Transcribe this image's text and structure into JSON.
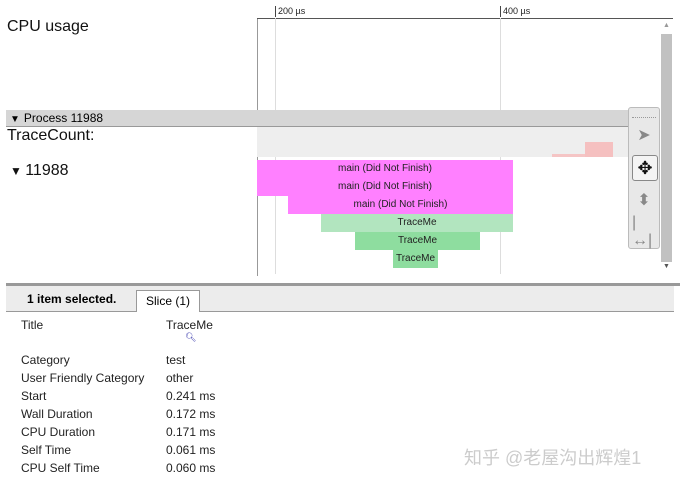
{
  "tracks": {
    "cpu_usage": "CPU usage",
    "process_label": "Process 11988",
    "trace_count": "TraceCount:",
    "thread": "11988"
  },
  "ruler": {
    "ticks": [
      "200 µs",
      "400 µs"
    ]
  },
  "slices": [
    {
      "label": "main (Did Not Finish)",
      "color": "#ff80ff"
    },
    {
      "label": "main (Did Not Finish)",
      "color": "#ff80ff"
    },
    {
      "label": "main (Did Not Finish)",
      "color": "#ff80ff"
    },
    {
      "label": "TraceMe",
      "color": "#b2e5bf"
    },
    {
      "label": "TraceMe",
      "color": "#8edd9f"
    },
    {
      "label": "TraceMe",
      "color": "#8edd9f"
    }
  ],
  "details": {
    "selected_text": "1 item selected.",
    "tab": "Slice (1)",
    "rows": [
      {
        "k": "Title",
        "v": "TraceMe"
      },
      {
        "k": "Category",
        "v": "test"
      },
      {
        "k": "User Friendly Category",
        "v": "other"
      },
      {
        "k": "Start",
        "v": "0.241 ms"
      },
      {
        "k": "Wall Duration",
        "v": "0.172 ms"
      },
      {
        "k": "CPU Duration",
        "v": "0.171 ms"
      },
      {
        "k": "Self Time",
        "v": "0.061 ms"
      },
      {
        "k": "CPU Self Time",
        "v": "0.060 ms"
      }
    ]
  },
  "watermark": "知乎 @老屋沟出辉煌1"
}
